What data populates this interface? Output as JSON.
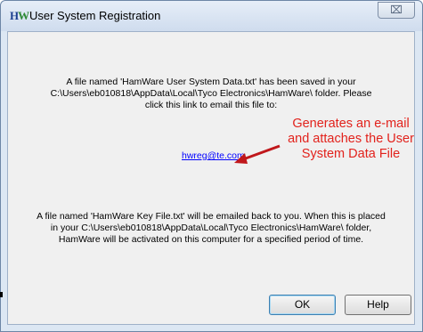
{
  "window": {
    "title": "User System Registration",
    "close_glyph": "⌧",
    "icon": "hamware-app-icon"
  },
  "body": {
    "message1_lines": [
      "A file named 'HamWare User System Data.txt' has been saved in your",
      "C:\\Users\\eb010818\\AppData\\Local\\Tyco Electronics\\HamWare\\ folder.  Please",
      "click this link to email this file to:"
    ],
    "email_link": "hwreg@te.com",
    "message2_lines": [
      "A file named 'HamWare Key File.txt' will be emailed back to you.  When this is placed",
      "in your C:\\Users\\eb010818\\AppData\\Local\\Tyco Electronics\\HamWare\\ folder,",
      "HamWare will be activated on this computer for a specified period of time."
    ]
  },
  "annotation": {
    "lines": [
      "Generates an e-mail",
      "and attaches the User",
      "System Data File"
    ],
    "color": "#e2221c"
  },
  "buttons": {
    "ok": "OK",
    "help": "Help"
  }
}
